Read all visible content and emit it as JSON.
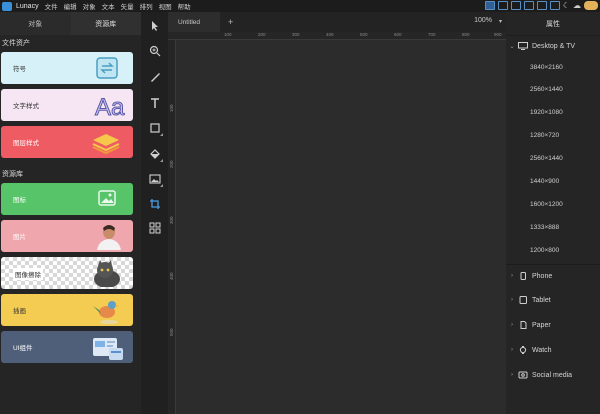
{
  "app": {
    "name": "Lunacy",
    "menu": [
      "文件",
      "编辑",
      "对象",
      "文本",
      "矢量",
      "排列",
      "视图",
      "帮助"
    ]
  },
  "left_panel": {
    "tabs": [
      "对象",
      "资源库"
    ],
    "active_tab": 1,
    "section_docs": "文件资产",
    "section_library": "资源库",
    "cards": [
      {
        "label": "符号",
        "color": "#d6f2f8"
      },
      {
        "label": "文字样式",
        "color": "#f6e6f3"
      },
      {
        "label": "图层样式",
        "color": "#ef5b62"
      },
      {
        "label": "图标",
        "color": "#58c46a"
      },
      {
        "label": "图片",
        "color": "#f0a6ad"
      },
      {
        "label": "图像擦除",
        "color": "#ffffff"
      },
      {
        "label": "插画",
        "color": "#f5cc52"
      },
      {
        "label": "UI组件",
        "color": "#4f5f7a"
      }
    ]
  },
  "toolbar": {
    "tools": [
      "select-icon",
      "zoom-icon",
      "pen-icon",
      "text-icon",
      "rectangle-icon",
      "fill-icon",
      "image-icon",
      "crop-icon",
      "components-icon"
    ]
  },
  "canvas": {
    "tab_title": "Untitled",
    "add_tab": "+",
    "zoom": "100%",
    "ruler_top": [
      "100",
      "200",
      "300",
      "400",
      "500",
      "600",
      "700",
      "800",
      "900"
    ],
    "ruler_left": [
      "100",
      "200",
      "300",
      "400",
      "500"
    ]
  },
  "right_panel": {
    "header": "属性",
    "groups": [
      {
        "name": "Desktop & TV",
        "expanded": true,
        "presets": [
          "3840×2160",
          "2560×1440",
          "1920×1080",
          "1280×720",
          "2560×1440",
          "1440×900",
          "1600×1200",
          "1333×888",
          "1200×800"
        ]
      },
      {
        "name": "Phone",
        "expanded": false
      },
      {
        "name": "Tablet",
        "expanded": false
      },
      {
        "name": "Paper",
        "expanded": false
      },
      {
        "name": "Watch",
        "expanded": false
      },
      {
        "name": "Social media",
        "expanded": false
      }
    ]
  }
}
